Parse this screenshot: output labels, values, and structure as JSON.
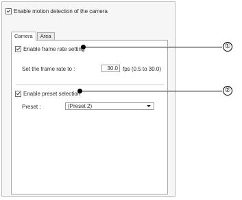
{
  "motion_detection": {
    "checked": true,
    "label": "Enable motion detection of the camera"
  },
  "tabs": [
    {
      "label": "Camera",
      "active": true
    },
    {
      "label": "Area",
      "active": false
    }
  ],
  "frame_rate": {
    "checked": true,
    "label": "Enable frame rate setting",
    "set_label": "Set the frame rate to :",
    "value": "30.0",
    "unit": "fps (0.5 to 30.0)"
  },
  "preset": {
    "checked": true,
    "label": "Enable preset selection",
    "preset_label": "Preset :",
    "selected": "(Preset 2)"
  },
  "callouts": [
    {
      "number": "①"
    },
    {
      "number": "②"
    }
  ]
}
